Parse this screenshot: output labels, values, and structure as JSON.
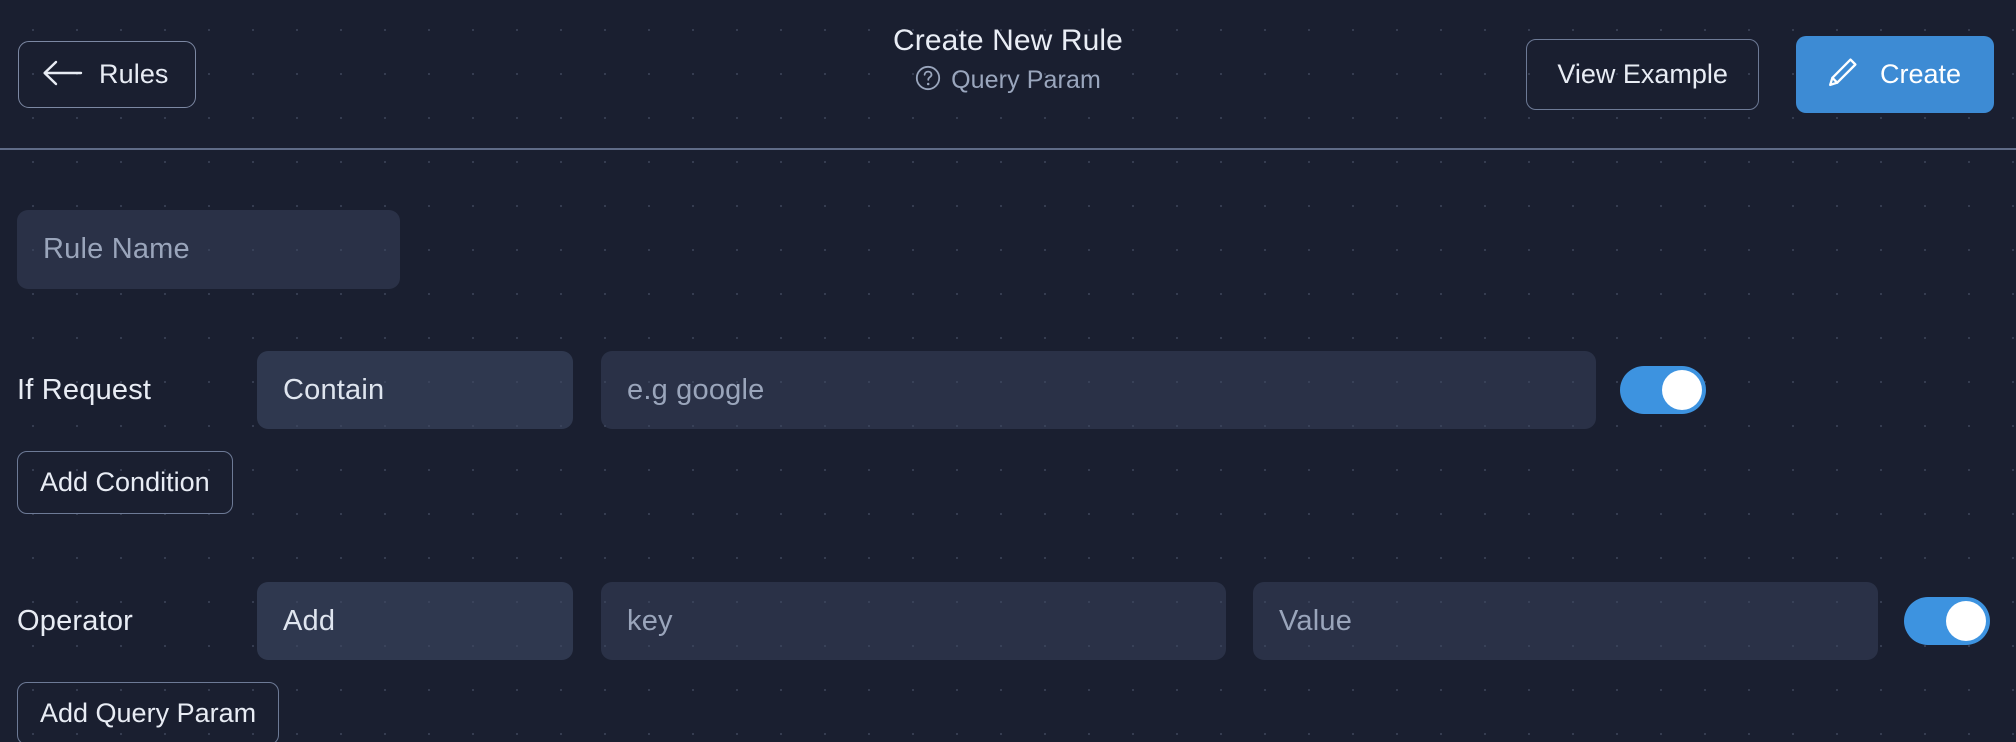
{
  "header": {
    "back_button": {
      "label": "Rules",
      "icon": "arrow-left-icon"
    },
    "title": "Create New Rule",
    "subtitle": "Query Param",
    "subtitle_icon": "question-circle-icon",
    "view_example_label": "View Example",
    "create_label": "Create",
    "create_icon": "pencil-icon",
    "accent_color": "#3d8bd4"
  },
  "form": {
    "rule_name": {
      "placeholder": "Rule Name",
      "value": ""
    },
    "condition": {
      "label": "If Request",
      "operator_value": "Contain",
      "value_placeholder": "e.g google",
      "value": "",
      "toggle_on": "true",
      "add_button_label": "Add Condition"
    },
    "operator": {
      "label": "Operator",
      "action_value": "Add",
      "key_placeholder": "key",
      "key_value": "",
      "value_placeholder": "Value",
      "value_value": "",
      "toggle_on": "true",
      "add_button_label": "Add Query Param"
    }
  },
  "theme": {
    "background": "#1a1f30",
    "field_background": "#3e4962",
    "toggle_on_color": "#3d93e0",
    "text_primary": "#e8ecf4",
    "text_muted": "#9aa5bb"
  }
}
